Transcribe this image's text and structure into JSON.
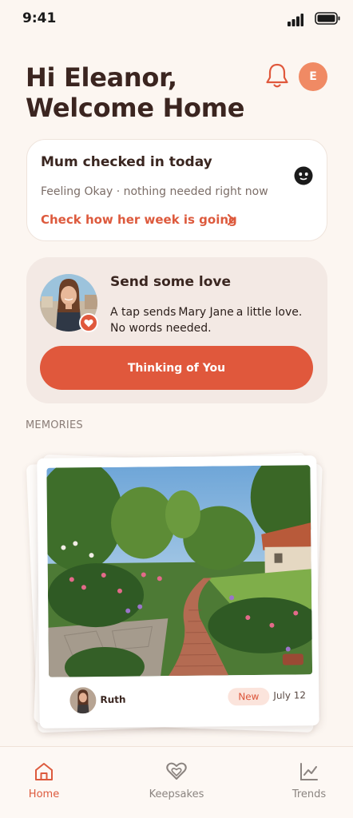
{
  "status_bar": {
    "time": "9:41"
  },
  "header": {
    "greeting_line1": "Hi Eleanor,",
    "greeting_line2": "Welcome Home",
    "avatar_initial": "E"
  },
  "checkin": {
    "title": "Mum checked in today",
    "status": "Feeling Okay · nothing needed right now",
    "link": "Check how her week is going"
  },
  "love": {
    "title": "Send some love",
    "text_before": "A tap sends",
    "name": "Mary Jane",
    "text_after": "a little love.",
    "text_line2": "No words needed.",
    "button": "Thinking of You"
  },
  "memories": {
    "section_label": "MEMORIES",
    "author": "Ruth",
    "badge": "New",
    "date": "July 12"
  },
  "tabs": [
    {
      "label": "Home",
      "icon": "home-icon",
      "active": true
    },
    {
      "label": "Keepsakes",
      "icon": "heart-icon",
      "active": false
    },
    {
      "label": "Trends",
      "icon": "chart-icon",
      "active": false
    }
  ],
  "colors": {
    "accent": "#e0583c",
    "background": "#fcf6f1",
    "love_card": "#f3e9e4",
    "text_dark": "#3a2620"
  }
}
